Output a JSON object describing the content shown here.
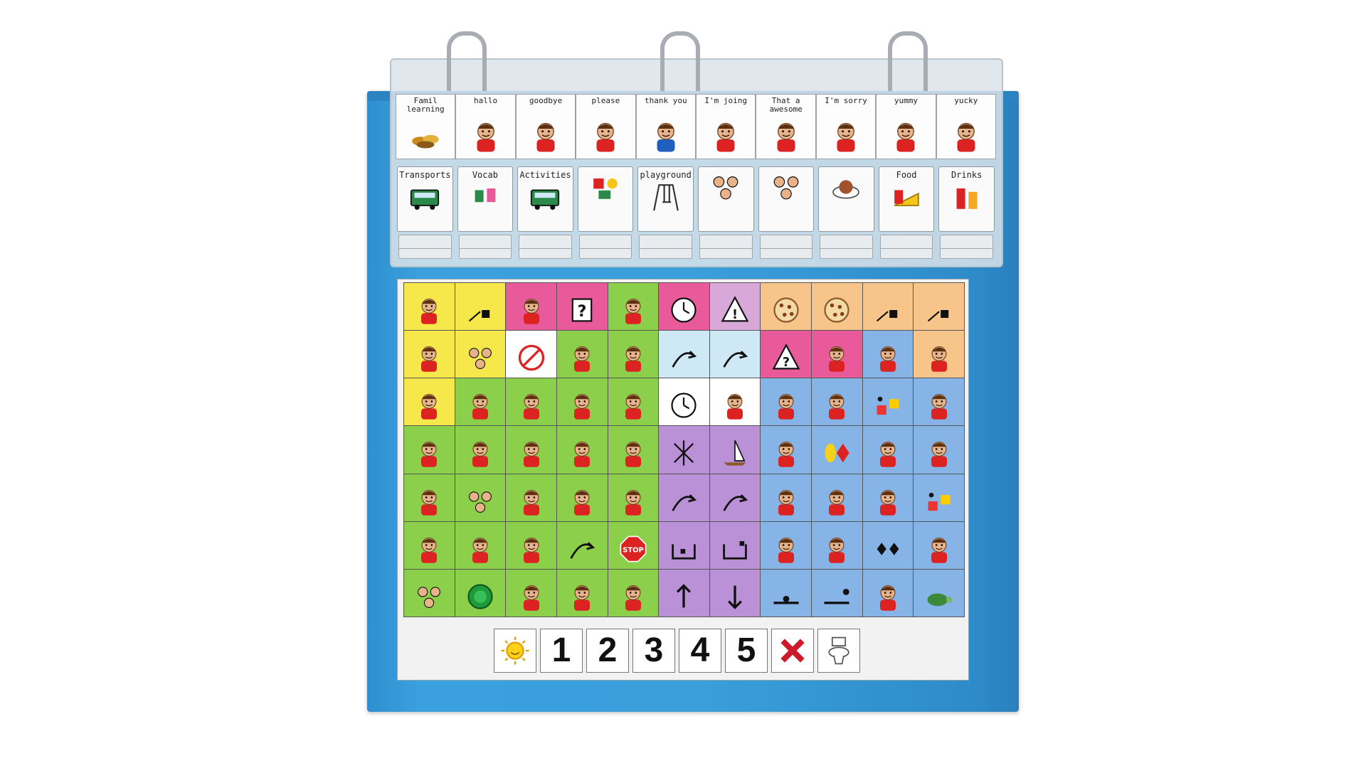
{
  "phrase_tiles": [
    {
      "label": "Famil\nlearning",
      "icon": "leaves-icon"
    },
    {
      "label": "hallo",
      "icon": "wave-person-icon"
    },
    {
      "label": "goodbye",
      "icon": "wave-girl-icon"
    },
    {
      "label": "please",
      "icon": "please-person-icon"
    },
    {
      "label": "thank you",
      "icon": "thank-you-person-icon"
    },
    {
      "label": "I'm joing",
      "icon": "face-icon"
    },
    {
      "label": "That a\nawesome",
      "icon": "cheer-person-icon"
    },
    {
      "label": "I'm sorry",
      "icon": "two-people-icon"
    },
    {
      "label": "yummy",
      "icon": "yummy-person-icon"
    },
    {
      "label": "yucky",
      "icon": "yucky-face-icon"
    }
  ],
  "category_tabs": [
    {
      "label": "Transports",
      "icon": "vehicles-icon"
    },
    {
      "label": "Vocab",
      "icon": "vocab-icon"
    },
    {
      "label": "Activities",
      "icon": "bus-icon"
    },
    {
      "label": "",
      "icon": "toys-icon"
    },
    {
      "label": "playground",
      "icon": "swing-icon"
    },
    {
      "label": "",
      "icon": "faces-icon"
    },
    {
      "label": "",
      "icon": "people-icon"
    },
    {
      "label": "",
      "icon": "food-plate-icon"
    },
    {
      "label": "Food",
      "icon": "cheese-icon"
    },
    {
      "label": "Drinks",
      "icon": "drinks-icon"
    }
  ],
  "grid_cells": [
    {
      "label": "",
      "bg": "#f6e84a",
      "icon": "person-icon"
    },
    {
      "label": "",
      "bg": "#f6e84a",
      "icon": "blue-square-arrow-icon"
    },
    {
      "label": "",
      "bg": "#e85a9a",
      "icon": "ear-head-icon"
    },
    {
      "label": "",
      "bg": "#e85a9a",
      "icon": "question-box-icon"
    },
    {
      "label": "",
      "bg": "#8ccf4a",
      "icon": "hand-point-icon"
    },
    {
      "label": "",
      "bg": "#e85a9a",
      "icon": "clock-question-icon"
    },
    {
      "label": "",
      "bg": "#d8a8d8",
      "icon": "warning-icon"
    },
    {
      "label": "",
      "bg": "#f7c58a",
      "icon": "pizza-icon"
    },
    {
      "label": "",
      "bg": "#f7c58a",
      "icon": "cookie-icon"
    },
    {
      "label": "",
      "bg": "#f7c58a",
      "icon": "arrow-square-icon"
    },
    {
      "label": "",
      "bg": "#f7c58a",
      "icon": "down-arrow-square-icon"
    },
    {
      "label": "",
      "bg": "#f6e84a",
      "icon": "two-people-icon"
    },
    {
      "label": "",
      "bg": "#f6e84a",
      "icon": "group-icon"
    },
    {
      "label": "",
      "bg": "#ffffff",
      "icon": "no-icon"
    },
    {
      "label": "",
      "bg": "#8ccf4a",
      "icon": "person-icon"
    },
    {
      "label": "",
      "bg": "#8ccf4a",
      "icon": "hand-icon"
    },
    {
      "label": "",
      "bg": "#cfe8f5",
      "icon": "curve-arrow-icon"
    },
    {
      "label": "",
      "bg": "#cfe8f5",
      "icon": "small-arrow-icon"
    },
    {
      "label": "",
      "bg": "#e85a9a",
      "icon": "warning-question-icon"
    },
    {
      "label": "",
      "bg": "#e85a9a",
      "icon": "shrug-person-icon"
    },
    {
      "label": "",
      "bg": "#86b4e6",
      "icon": "thumb-icon"
    },
    {
      "label": "",
      "bg": "#f7c58a",
      "icon": "thinking-face-icon"
    },
    {
      "label": "",
      "bg": "#f6e84a",
      "icon": "fist-icon"
    },
    {
      "label": "",
      "bg": "#8ccf4a",
      "icon": "face-icon"
    },
    {
      "label": "",
      "bg": "#8ccf4a",
      "icon": "head-icon"
    },
    {
      "label": "",
      "bg": "#8ccf4a",
      "icon": "two-faces-icon"
    },
    {
      "label": "",
      "bg": "#8ccf4a",
      "icon": "give-icon"
    },
    {
      "label": "",
      "bg": "#ffffff",
      "icon": "clock-icon"
    },
    {
      "label": "",
      "bg": "#ffffff",
      "icon": "run-icon"
    },
    {
      "label": "",
      "bg": "#86b4e6",
      "icon": "person-icon"
    },
    {
      "label": "",
      "bg": "#86b4e6",
      "icon": "thumb-down-icon"
    },
    {
      "label": "",
      "bg": "#86b4e6",
      "icon": "shapes-icon"
    },
    {
      "label": "",
      "bg": "#86b4e6",
      "icon": "shirt-icon"
    },
    {
      "label": "",
      "bg": "#8ccf4a",
      "icon": "two-people-icon"
    },
    {
      "label": "",
      "bg": "#8ccf4a",
      "icon": "door-icon"
    },
    {
      "label": "",
      "bg": "#8ccf4a",
      "icon": "shh-icon"
    },
    {
      "label": "",
      "bg": "#8ccf4a",
      "icon": "two-people-icon"
    },
    {
      "label": "",
      "bg": "#8ccf4a",
      "icon": "egg-icon"
    },
    {
      "label": "",
      "bg": "#ba90d6",
      "icon": "star-cross-icon"
    },
    {
      "label": "",
      "bg": "#ba90d6",
      "icon": "boat-icon"
    },
    {
      "label": "",
      "bg": "#86b4e6",
      "icon": "face-icon"
    },
    {
      "label": "",
      "bg": "#86b4e6",
      "icon": "oval-diamond-icon"
    },
    {
      "label": "",
      "bg": "#86b4e6",
      "icon": "shirt-icon"
    },
    {
      "label": "",
      "bg": "#86b4e6",
      "icon": "shirt-icon"
    },
    {
      "label": "",
      "bg": "#8ccf4a",
      "icon": "face-arrow-icon"
    },
    {
      "label": "",
      "bg": "#8ccf4a",
      "icon": "people-icon"
    },
    {
      "label": "",
      "bg": "#8ccf4a",
      "icon": "mounds-icon"
    },
    {
      "label": "",
      "bg": "#8ccf4a",
      "icon": "two-people-icon"
    },
    {
      "label": "",
      "bg": "#8ccf4a",
      "icon": "wash-icon"
    },
    {
      "label": "",
      "bg": "#ba90d6",
      "icon": "cross-arrow-icon"
    },
    {
      "label": "",
      "bg": "#ba90d6",
      "icon": "diagonal-arrow-icon"
    },
    {
      "label": "",
      "bg": "#86b4e6",
      "icon": "thumb-icon"
    },
    {
      "label": "",
      "bg": "#86b4e6",
      "icon": "happy-face-icon"
    },
    {
      "label": "",
      "bg": "#86b4e6",
      "icon": "sun-face-icon"
    },
    {
      "label": "",
      "bg": "#86b4e6",
      "icon": "shapes-icon"
    },
    {
      "label": "",
      "bg": "#8ccf4a",
      "icon": "person-icon"
    },
    {
      "label": "",
      "bg": "#8ccf4a",
      "icon": "two-people-icon"
    },
    {
      "label": "",
      "bg": "#8ccf4a",
      "icon": "sit-icon"
    },
    {
      "label": "",
      "bg": "#8ccf4a",
      "icon": "arrows-icon"
    },
    {
      "label": "",
      "bg": "#8ccf4a",
      "icon": "stop-icon"
    },
    {
      "label": "",
      "bg": "#ba90d6",
      "icon": "in-icon"
    },
    {
      "label": "",
      "bg": "#ba90d6",
      "icon": "out-icon"
    },
    {
      "label": "",
      "bg": "#86b4e6",
      "icon": "person-icon"
    },
    {
      "label": "",
      "bg": "#86b4e6",
      "icon": "face-icon"
    },
    {
      "label": "",
      "bg": "#86b4e6",
      "icon": "diamonds-icon"
    },
    {
      "label": "",
      "bg": "#86b4e6",
      "icon": "slide-icon"
    },
    {
      "label": "",
      "bg": "#8ccf4a",
      "icon": "people-icon"
    },
    {
      "label": "",
      "bg": "#8ccf4a",
      "icon": "green-circle-icon"
    },
    {
      "label": "",
      "bg": "#8ccf4a",
      "icon": "sit-icon"
    },
    {
      "label": "",
      "bg": "#8ccf4a",
      "icon": "person-icon"
    },
    {
      "label": "",
      "bg": "#8ccf4a",
      "icon": "desk-icon"
    },
    {
      "label": "",
      "bg": "#ba90d6",
      "icon": "up-arrow-icon"
    },
    {
      "label": "",
      "bg": "#ba90d6",
      "icon": "down-arrow-icon"
    },
    {
      "label": "",
      "bg": "#86b4e6",
      "icon": "on-icon"
    },
    {
      "label": "",
      "bg": "#86b4e6",
      "icon": "off-icon"
    },
    {
      "label": "",
      "bg": "#86b4e6",
      "icon": "face-exclaim-icon"
    },
    {
      "label": "",
      "bg": "#86b4e6",
      "icon": "turtle-icon"
    }
  ],
  "number_strip": [
    {
      "text": "",
      "icon": "sun-icon"
    },
    {
      "text": "1"
    },
    {
      "text": "2"
    },
    {
      "text": "3"
    },
    {
      "text": "4"
    },
    {
      "text": "5"
    },
    {
      "text": "",
      "icon": "red-x-icon"
    },
    {
      "text": "",
      "icon": "toilet-icon"
    }
  ],
  "colors": {
    "binder_blue": "#3a9ddb",
    "yellow": "#f6e84a",
    "pink": "#e85a9a",
    "green": "#8ccf4a",
    "purple": "#ba90d6",
    "blue": "#86b4e6",
    "orange": "#f7c58a"
  }
}
